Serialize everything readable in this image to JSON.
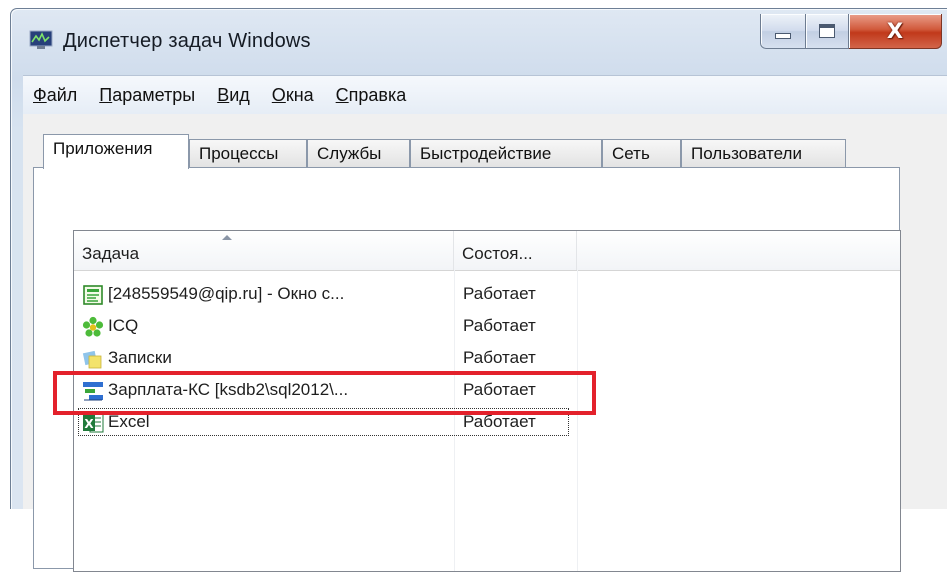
{
  "window": {
    "title": "Диспетчер задач Windows",
    "close_glyph": "X"
  },
  "menu": [
    {
      "hot": "Ф",
      "rest": "айл"
    },
    {
      "hot": "П",
      "rest": "араметры"
    },
    {
      "hot": "В",
      "rest": "ид"
    },
    {
      "hot": "О",
      "rest": "кна"
    },
    {
      "hot": "С",
      "rest": "правка"
    }
  ],
  "tabs": [
    {
      "label": "Приложения",
      "active": true
    },
    {
      "label": "Процессы"
    },
    {
      "label": "Службы"
    },
    {
      "label": "Быстродействие"
    },
    {
      "label": "Сеть"
    },
    {
      "label": "Пользователи"
    }
  ],
  "list": {
    "columns": [
      "Задача",
      "Состоя..."
    ],
    "rows": [
      {
        "name": "[248559549@qip.ru] - Окно с...",
        "status": "Работает",
        "icon": "qip-chat-icon"
      },
      {
        "name": "ICQ",
        "status": "Работает",
        "icon": "icq-flower-icon"
      },
      {
        "name": "Записки",
        "status": "Работает",
        "icon": "sticky-notes-icon"
      },
      {
        "name": "Зарплата-КС [ksdb2\\sql2012\\...",
        "status": "Работает",
        "icon": "payroll-app-icon"
      },
      {
        "name": "Excel",
        "status": "Работает",
        "icon": "excel-icon",
        "focused": true
      }
    ]
  },
  "colors": {
    "highlight": "#e3212b",
    "close_button": "#c1391b"
  }
}
